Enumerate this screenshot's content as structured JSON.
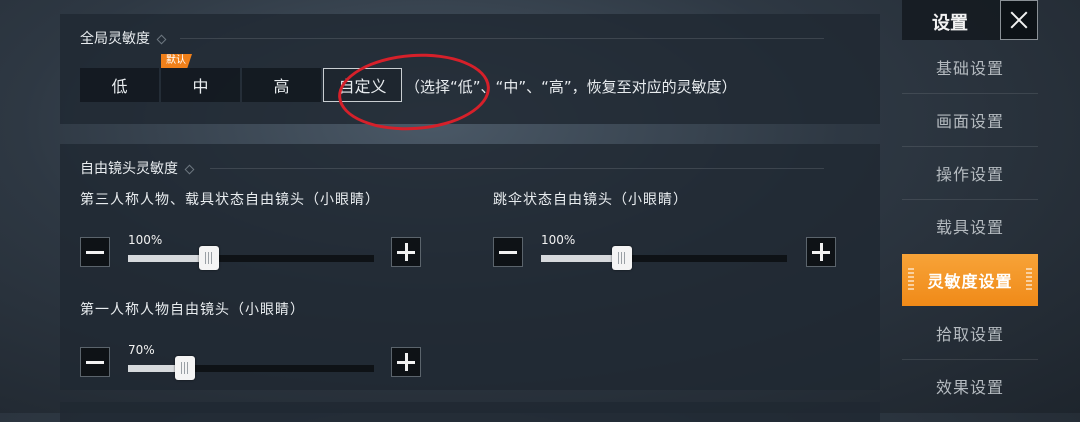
{
  "global_sensitivity": {
    "title": "全局灵敏度",
    "options": [
      "低",
      "中",
      "高",
      "自定义"
    ],
    "default_badge": "默认",
    "selected": "自定义",
    "hint": "（选择“低”、“中”、“高”，恢复至对应的灵敏度）"
  },
  "free_look": {
    "title": "自由镜头灵敏度",
    "sliders": [
      {
        "label": "第三人称人物、载具状态自由镜头（小眼睛）",
        "value_text": "100%",
        "value": 0.33
      },
      {
        "label": "跳伞状态自由镜头（小眼睛）",
        "value_text": "100%",
        "value": 0.33
      },
      {
        "label": "第一人称人物自由镜头（小眼睛）",
        "value_text": "70%",
        "value": 0.23
      }
    ]
  },
  "sidebar": {
    "title": "设置",
    "items": [
      "基础设置",
      "画面设置",
      "操作设置",
      "载具设置",
      "灵敏度设置",
      "拾取设置",
      "效果设置"
    ],
    "active": "灵敏度设置"
  },
  "colors": {
    "accent": "#f08a18",
    "annotation": "#d6202a"
  }
}
